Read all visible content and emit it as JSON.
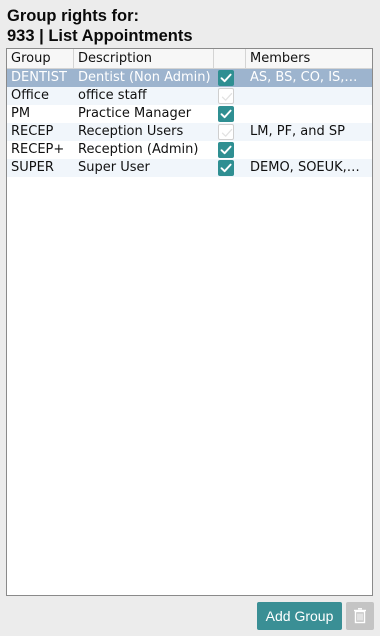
{
  "title": {
    "line1": "Group rights for:",
    "line2": "933 | List Appointments"
  },
  "table": {
    "columns": [
      "Group",
      "Description",
      "",
      "Members"
    ],
    "rows": [
      {
        "group": "DENTIST",
        "description": "Dentist (Non Admin)",
        "checked": true,
        "members": "AS, BS, CO, IS,…",
        "selected": true
      },
      {
        "group": "Office",
        "description": "office staff",
        "checked": false,
        "members": "",
        "selected": false
      },
      {
        "group": "PM",
        "description": "Practice Manager",
        "checked": true,
        "members": "",
        "selected": false
      },
      {
        "group": "RECEP",
        "description": "Reception Users",
        "checked": false,
        "members": "LM, PF, and SP",
        "selected": false
      },
      {
        "group": "RECEP+",
        "description": "Reception (Admin)",
        "checked": true,
        "members": "",
        "selected": false
      },
      {
        "group": "SUPER",
        "description": "Super User",
        "checked": true,
        "members": "DEMO, SOEUK,…",
        "selected": false
      }
    ]
  },
  "buttons": {
    "add_group": "Add Group",
    "delete_icon": "trash-icon"
  },
  "colors": {
    "accent": "#3a8f95",
    "selected_row": "#9db4ce",
    "check_on": "#2f8f92"
  }
}
